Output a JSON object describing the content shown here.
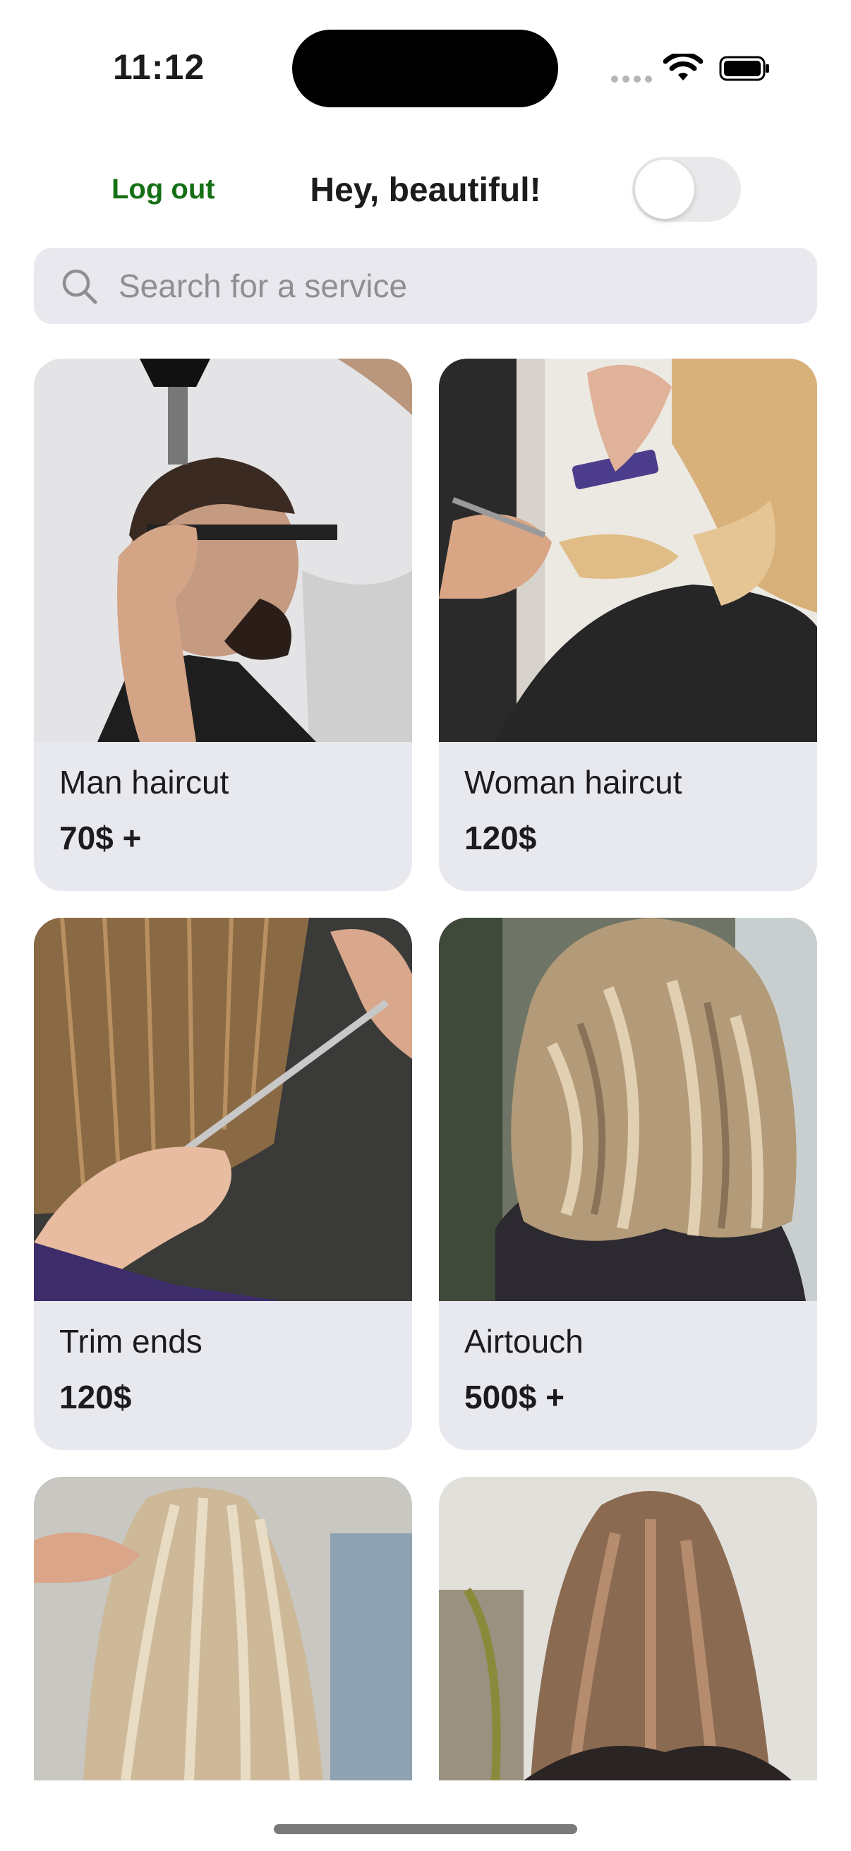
{
  "status_bar": {
    "time": "11:12",
    "icons": [
      "cellular-signal-icon",
      "wifi-icon",
      "battery-icon"
    ]
  },
  "header": {
    "logout_label": "Log out",
    "greeting": "Hey, beautiful!",
    "toggle_state": "off"
  },
  "search": {
    "placeholder": "Search for a service",
    "value": "",
    "icon": "search-icon"
  },
  "services": [
    {
      "name": "Man haircut",
      "price": "70$ +"
    },
    {
      "name": "Woman haircut",
      "price": "120$"
    },
    {
      "name": "Trim ends",
      "price": "120$"
    },
    {
      "name": "Airtouch",
      "price": "500$ +"
    },
    {
      "name": "",
      "price": ""
    },
    {
      "name": "",
      "price": ""
    }
  ],
  "colors": {
    "accent_green": "#157015",
    "card_bg": "#e8e8ef",
    "search_bg": "#e8e8ee",
    "toggle_off": "#e9e9eb"
  }
}
